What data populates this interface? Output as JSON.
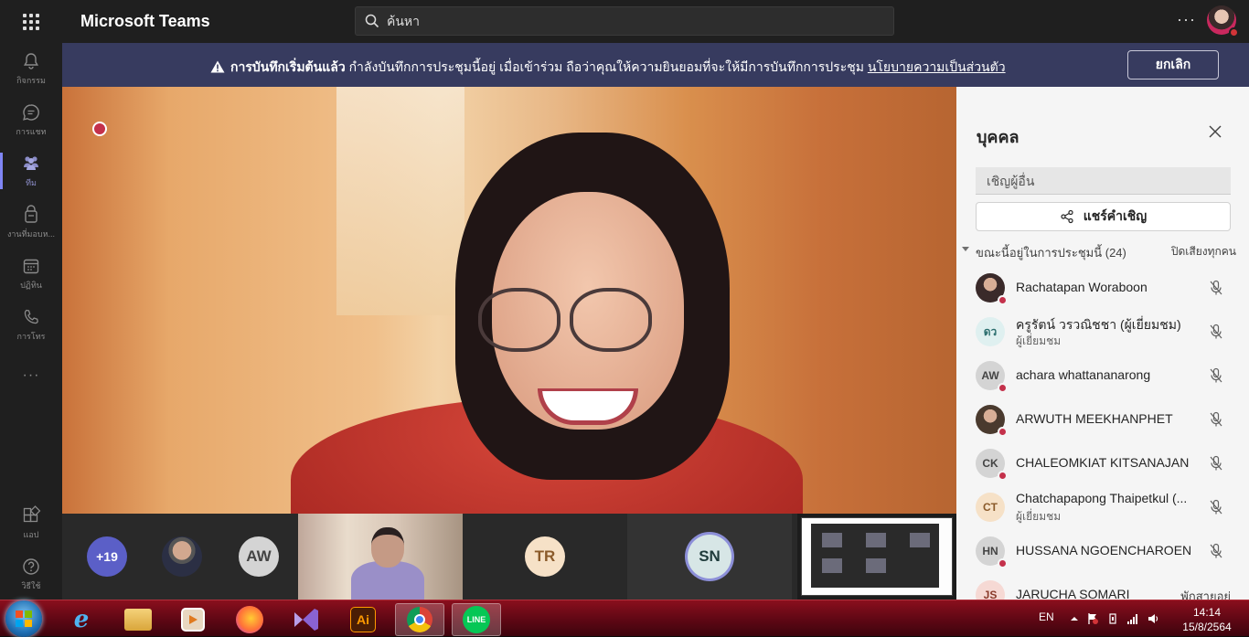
{
  "app": {
    "title": "Microsoft Teams"
  },
  "search": {
    "placeholder": "ค้นหา"
  },
  "topbar": {
    "more_label": "···"
  },
  "rail": [
    {
      "label": "กิจกรรม",
      "icon": "bell-icon"
    },
    {
      "label": "การแชท",
      "icon": "chat-icon"
    },
    {
      "label": "ทีม",
      "icon": "teams-icon",
      "active": true
    },
    {
      "label": "งานที่มอบห...",
      "icon": "assignments-icon"
    },
    {
      "label": "ปฏิทิน",
      "icon": "calendar-icon"
    },
    {
      "label": "การโทร",
      "icon": "phone-icon"
    },
    {
      "label": "···",
      "icon": "more-icon"
    },
    {
      "label": "แอป",
      "icon": "apps-icon"
    },
    {
      "label": "วิธีใช้",
      "icon": "help-icon"
    }
  ],
  "banner": {
    "bold": "การบันทึกเริ่มต้นแล้ว",
    "text": " กำลังบันทึกการประชุมนี้อยู่ เมื่อเข้าร่วม ถือว่าคุณให้ความยินยอมที่จะให้มีการบันทึกการประชุม ",
    "link": "นโยบายความเป็นส่วนตัว",
    "cancel": "ยกเลิก"
  },
  "strip": {
    "more_count": "+19",
    "aw": "AW",
    "tr": "TR",
    "sn": "SN"
  },
  "people": {
    "title": "บุคคล",
    "invite_placeholder": "เชิญผู้อื่น",
    "share_label": "แชร์คำเชิญ",
    "section_label": "ขณะนี้อยู่ในการประชุมนี้ (24)",
    "mute_all": "ปิดเสียงทุกคน",
    "list": [
      {
        "name": "Rachatapan Woraboon",
        "initials": "",
        "sub": "",
        "bg": "#3a2a2a",
        "fg": "#fff",
        "photo": true,
        "status": true
      },
      {
        "name": "ครูรัตน์ วรวณิชชา (ผู้เยี่ยมชม)",
        "initials": "ดว",
        "sub": "ผู้เยี่ยมชม",
        "bg": "#dff0f0",
        "fg": "#2b6e6e",
        "photo": false,
        "status": false
      },
      {
        "name": "achara whattananarong",
        "initials": "AW",
        "sub": "",
        "bg": "#d4d4d4",
        "fg": "#444",
        "photo": false,
        "status": true
      },
      {
        "name": "ARWUTH MEEKHANPHET",
        "initials": "",
        "sub": "",
        "bg": "#4a3a2e",
        "fg": "#fff",
        "photo": true,
        "status": true
      },
      {
        "name": "CHALEOMKIAT KITSANAJAN",
        "initials": "CK",
        "sub": "",
        "bg": "#d4d4d4",
        "fg": "#444",
        "photo": false,
        "status": true
      },
      {
        "name": "Chatchapapong Thaipetkul (...",
        "initials": "CT",
        "sub": "ผู้เยี่ยมชม",
        "bg": "#f6e1c7",
        "fg": "#8a5a2a",
        "photo": false,
        "status": false
      },
      {
        "name": "HUSSANA NGOENCHAROEN",
        "initials": "HN",
        "sub": "",
        "bg": "#d4d4d4",
        "fg": "#444",
        "photo": false,
        "status": true
      },
      {
        "name": "JARUCHA SOMARI",
        "initials": "JS",
        "sub": "",
        "bg": "#f6d9d4",
        "fg": "#8a3a2a",
        "photo": false,
        "status": false,
        "right": "พักสายอยู่"
      }
    ]
  },
  "taskbar": {
    "apps": [
      "windows-start",
      "internet-explorer",
      "file-explorer",
      "media-player",
      "firefox",
      "visual-studio",
      "illustrator",
      "chrome",
      "line"
    ],
    "ai_label": "Ai",
    "line_label": "LINE",
    "lang": "EN",
    "time": "14:14",
    "date": "15/8/2564"
  }
}
